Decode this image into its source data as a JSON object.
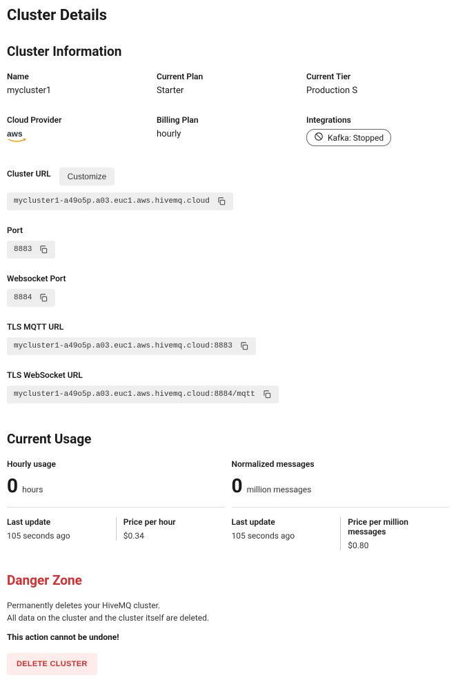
{
  "page": {
    "title": "Cluster Details"
  },
  "cluster_info": {
    "heading": "Cluster Information",
    "name": {
      "label": "Name",
      "value": "mycluster1"
    },
    "current_plan": {
      "label": "Current Plan",
      "value": "Starter"
    },
    "current_tier": {
      "label": "Current Tier",
      "value": "Production S"
    },
    "cloud_provider": {
      "label": "Cloud Provider",
      "value": "aws"
    },
    "billing_plan": {
      "label": "Billing Plan",
      "value": "hourly"
    },
    "integrations": {
      "label": "Integrations",
      "value": "Kafka: Stopped"
    }
  },
  "connection": {
    "cluster_url": {
      "label": "Cluster URL",
      "customize_label": "Customize",
      "value": "mycluster1-a49o5p.a03.euc1.aws.hivemq.cloud"
    },
    "port": {
      "label": "Port",
      "value": "8883"
    },
    "websocket_port": {
      "label": "Websocket Port",
      "value": "8884"
    },
    "tls_mqtt_url": {
      "label": "TLS MQTT URL",
      "value": "mycluster1-a49o5p.a03.euc1.aws.hivemq.cloud:8883"
    },
    "tls_websocket_url": {
      "label": "TLS WebSocket URL",
      "value": "mycluster1-a49o5p.a03.euc1.aws.hivemq.cloud:8884/mqtt"
    }
  },
  "usage": {
    "heading": "Current Usage",
    "hourly": {
      "title": "Hourly usage",
      "value": "0",
      "unit": "hours",
      "last_update": {
        "label": "Last update",
        "value": "105 seconds ago"
      },
      "price": {
        "label": "Price per hour",
        "value": "$0.34"
      }
    },
    "messages": {
      "title": "Normalized messages",
      "value": "0",
      "unit": "million messages",
      "last_update": {
        "label": "Last update",
        "value": "105 seconds ago"
      },
      "price": {
        "label": "Price per million messages",
        "value": "$0.80"
      }
    }
  },
  "danger": {
    "heading": "Danger Zone",
    "line1": "Permanently deletes your HiveMQ cluster.",
    "line2": "All data on the cluster and the cluster itself are deleted.",
    "warning": "This action cannot be undone!",
    "delete_label": "DELETE CLUSTER"
  }
}
